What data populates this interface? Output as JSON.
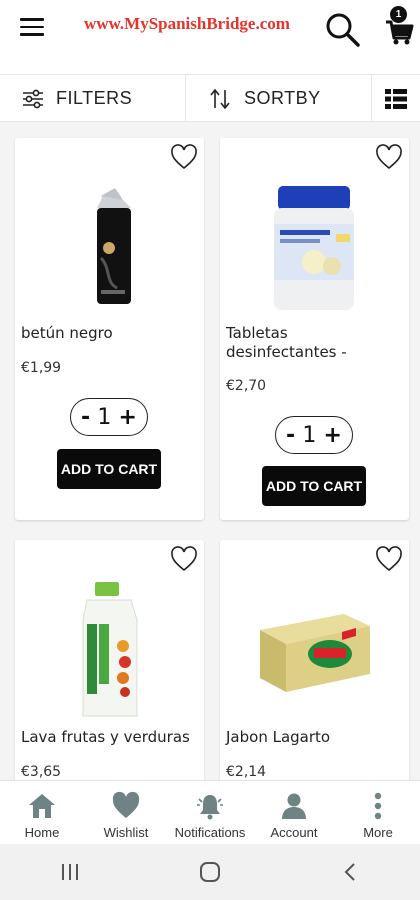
{
  "header": {
    "brand": "www.MySpanishBridge.com",
    "cart_count": "1",
    "brand_color": "#e8322b"
  },
  "toolbar": {
    "filters_label": "FILTERS",
    "sort_label": "SORTBY"
  },
  "products": [
    {
      "name": "betún negro",
      "price": "€1,99",
      "qty": "1",
      "add_label": "ADD TO CART"
    },
    {
      "name": "Tabletas desinfectantes -",
      "price": "€2,70",
      "qty": "1",
      "add_label": "ADD TO CART"
    },
    {
      "name": "Lava frutas y verduras",
      "price": "€3,65"
    },
    {
      "name": "Jabon Lagarto",
      "price": "€2,14"
    }
  ],
  "nav": {
    "items": [
      {
        "label": "Home",
        "icon": "home-icon"
      },
      {
        "label": "Wishlist",
        "icon": "heart-icon"
      },
      {
        "label": "Notifications",
        "icon": "bell-icon"
      },
      {
        "label": "Account",
        "icon": "person-icon"
      },
      {
        "label": "More",
        "icon": "more-vertical-icon"
      }
    ]
  },
  "colors": {
    "accent": "#0a0a0a",
    "icon_grey": "#6f8284"
  }
}
